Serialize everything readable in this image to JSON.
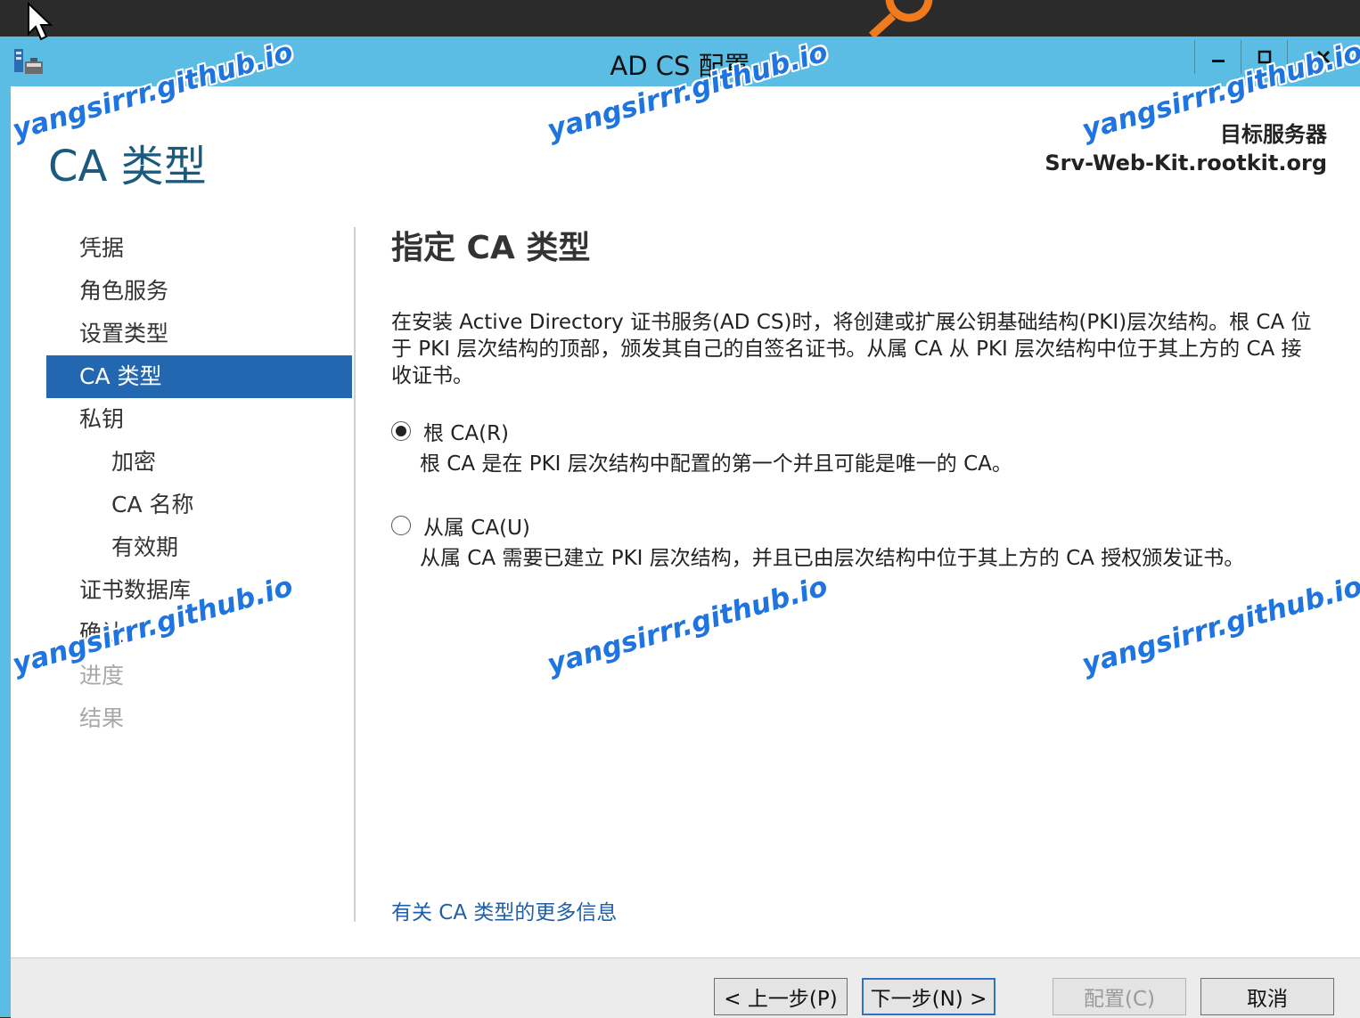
{
  "window": {
    "title": "AD CS 配置"
  },
  "page": {
    "title": "CA 类型",
    "target_label": "目标服务器",
    "target_server": "Srv-Web-Kit.rootkit.org"
  },
  "nav": {
    "items": [
      {
        "label": "凭据",
        "state": "normal",
        "indent": false
      },
      {
        "label": "角色服务",
        "state": "normal",
        "indent": false
      },
      {
        "label": "设置类型",
        "state": "normal",
        "indent": false
      },
      {
        "label": "CA 类型",
        "state": "active",
        "indent": false
      },
      {
        "label": "私钥",
        "state": "normal",
        "indent": false
      },
      {
        "label": "加密",
        "state": "normal",
        "indent": true
      },
      {
        "label": "CA 名称",
        "state": "normal",
        "indent": true
      },
      {
        "label": "有效期",
        "state": "normal",
        "indent": true
      },
      {
        "label": "证书数据库",
        "state": "normal",
        "indent": false
      },
      {
        "label": "确认",
        "state": "normal",
        "indent": false
      },
      {
        "label": "进度",
        "state": "disabled",
        "indent": false
      },
      {
        "label": "结果",
        "state": "disabled",
        "indent": false
      }
    ]
  },
  "content": {
    "heading": "指定 CA 类型",
    "description": "在安装 Active Directory 证书服务(AD CS)时，将创建或扩展公钥基础结构(PKI)层次结构。根 CA 位于 PKI 层次结构的顶部，颁发其自己的自签名证书。从属 CA 从 PKI 层次结构中位于其上方的 CA 接收证书。",
    "options": {
      "root": {
        "label": "根 CA(R)",
        "description": "根 CA 是在 PKI 层次结构中配置的第一个并且可能是唯一的 CA。",
        "selected": true
      },
      "subordinate": {
        "label": "从属 CA(U)",
        "description": "从属 CA 需要已建立 PKI 层次结构，并且已由层次结构中位于其上方的 CA 授权颁发证书。",
        "selected": false
      }
    },
    "more_link": "有关 CA 类型的更多信息"
  },
  "buttons": {
    "back": "< 上一步(P)",
    "next": "下一步(N) >",
    "configure": "配置(C)",
    "cancel": "取消"
  },
  "watermark": "yangsirrr.github.io",
  "colors": {
    "titlebar": "#5bbde4",
    "nav_active": "#2267b0",
    "title_text": "#1c5a7d",
    "link": "#1f5fa8",
    "watermark": "#1f74e0"
  }
}
